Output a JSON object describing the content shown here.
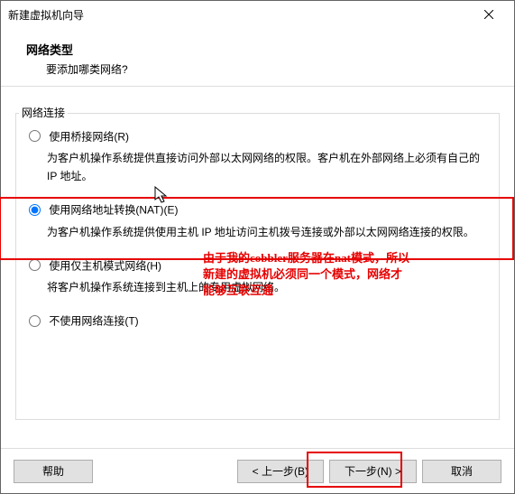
{
  "titlebar": {
    "title": "新建虚拟机向导"
  },
  "header": {
    "title": "网络类型",
    "subtitle": "要添加哪类网络?"
  },
  "fieldset": {
    "legend": "网络连接",
    "options": [
      {
        "label": "使用桥接网络(R)",
        "desc": "为客户机操作系统提供直接访问外部以太网网络的权限。客户机在外部网络上必须有自己的 IP 地址。"
      },
      {
        "label": "使用网络地址转换(NAT)(E)",
        "desc": "为客户机操作系统提供使用主机 IP 地址访问主机拨号连接或外部以太网网络连接的权限。"
      },
      {
        "label": "使用仅主机模式网络(H)",
        "desc": "将客户机操作系统连接到主机上的专用虚拟网络。"
      },
      {
        "label": "不使用网络连接(T)",
        "desc": ""
      }
    ]
  },
  "annotation": {
    "line1": "由于我的cobbler服务器在nat模式，所以",
    "line2": "新建的虚拟机必须同一个模式，网络才",
    "line3": "能够互联互通"
  },
  "footer": {
    "help": "帮助",
    "back": "< 上一步(B)",
    "next": "下一步(N) >",
    "cancel": "取消"
  }
}
